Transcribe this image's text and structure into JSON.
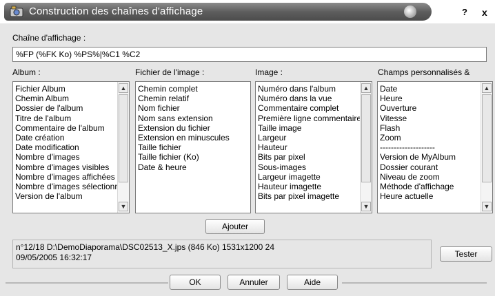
{
  "window": {
    "title": "Construction des chaînes d'affichage",
    "help_label": "?",
    "close_label": "x"
  },
  "display_string": {
    "label": "Chaîne d'affichage :",
    "value": "%FP (%FK Ko) %PS%|%C1 %C2"
  },
  "lists": {
    "album": {
      "label": "Album :",
      "items": [
        "Fichier Album",
        "Chemin Album",
        "Dossier de l'album",
        "Titre de l'album",
        "Commentaire de l'album",
        "Date création",
        "Date modification",
        "Nombre d'images",
        "Nombre d'images visibles",
        "Nombre d'images affichées",
        "Nombre d'images sélectionnées",
        "Version de l'album"
      ]
    },
    "image_file": {
      "label": "Fichier de l'image :",
      "items": [
        "Chemin complet",
        "Chemin relatif",
        "Nom fichier",
        "Nom sans extension",
        "Extension du fichier",
        "Extension en minuscules",
        "Taille fichier",
        "Taille fichier (Ko)",
        "Date & heure"
      ]
    },
    "image": {
      "label": "Image :",
      "items": [
        "Numéro dans l'album",
        "Numéro dans la vue",
        "Commentaire complet",
        "Première ligne commentaire",
        "Taille image",
        "Largeur",
        "Hauteur",
        "Bits par pixel",
        "Sous-images",
        "Largeur imagette",
        "Hauteur imagette",
        "Bits par pixel imagette"
      ]
    },
    "custom": {
      "label": "Champs personnalisés &",
      "items": [
        "Date",
        "Heure",
        "Ouverture",
        "Vitesse",
        "Flash",
        "Zoom",
        "--------------------",
        "Version de MyAlbum",
        "Dossier courant",
        "Niveau de zoom",
        "Méthode d'affichage",
        "Heure actuelle"
      ]
    }
  },
  "buttons": {
    "add": "Ajouter",
    "test": "Tester",
    "ok": "OK",
    "cancel": "Annuler",
    "help": "Aide"
  },
  "preview": {
    "line1": "n°12/18  D:\\DemoDiaporama\\DSC02513_X.jps  (846 Ko)  1531x1200 24",
    "line2": "09/05/2005 16:32:17"
  }
}
